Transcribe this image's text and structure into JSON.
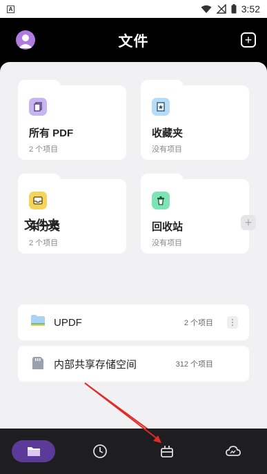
{
  "header": {
    "title": "文件",
    "time": "3:52"
  },
  "categories": [
    {
      "label": "所有 PDF",
      "count": "2 个项目",
      "icon": "pdf-files-icon"
    },
    {
      "label": "收藏夹",
      "count": "没有项目",
      "icon": "star-icon"
    },
    {
      "label": "未分类",
      "count": "2 个项目",
      "icon": "inbox-icon"
    },
    {
      "label": "回收站",
      "count": "没有项目",
      "icon": "trash-icon"
    }
  ],
  "folders_section": {
    "title": "文件夹"
  },
  "folders": [
    {
      "label": "UPDF",
      "count": "2 个项目"
    },
    {
      "label": "内部共享存储空间",
      "count": "312 个项目"
    }
  ],
  "colors": {
    "accent": "#5b3a99",
    "background": "#f1f1f3",
    "appbar": "#000000"
  }
}
